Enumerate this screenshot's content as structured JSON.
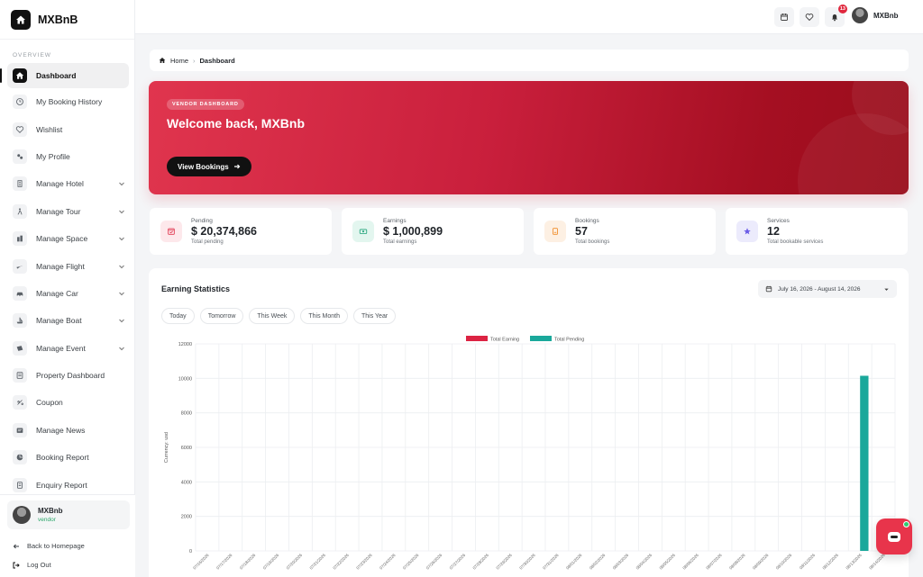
{
  "brand": {
    "name": "MXBnB"
  },
  "sidebar": {
    "section": "OVERVIEW",
    "items": [
      {
        "label": "Dashboard",
        "icon": "home-icon",
        "active": true
      },
      {
        "label": "My Booking History",
        "icon": "clock-icon"
      },
      {
        "label": "Wishlist",
        "icon": "heart-icon"
      },
      {
        "label": "My Profile",
        "icon": "users-icon"
      },
      {
        "label": "Manage Hotel",
        "icon": "building-icon",
        "expandable": true
      },
      {
        "label": "Manage Tour",
        "icon": "hiker-icon",
        "expandable": true
      },
      {
        "label": "Manage Space",
        "icon": "space-icon",
        "expandable": true
      },
      {
        "label": "Manage Flight",
        "icon": "plane-icon",
        "expandable": true
      },
      {
        "label": "Manage Car",
        "icon": "car-icon",
        "expandable": true
      },
      {
        "label": "Manage Boat",
        "icon": "boat-icon",
        "expandable": true
      },
      {
        "label": "Manage Event",
        "icon": "ticket-icon",
        "expandable": true
      },
      {
        "label": "Property Dashboard",
        "icon": "property-icon"
      },
      {
        "label": "Coupon",
        "icon": "coupon-icon"
      },
      {
        "label": "Manage News",
        "icon": "news-icon"
      },
      {
        "label": "Booking Report",
        "icon": "report-icon"
      },
      {
        "label": "Enquiry Report",
        "icon": "enquiry-icon"
      }
    ],
    "user": {
      "name": "MXBnb",
      "role": "vendor"
    },
    "back_link": "Back to Homepage",
    "logout": "Log Out"
  },
  "topbar": {
    "notifications": "13",
    "user_name": "MXBnb"
  },
  "breadcrumb": {
    "home": "Home",
    "current": "Dashboard"
  },
  "hero": {
    "tag": "VENDOR DASHBOARD",
    "title": "Welcome back, MXBnb",
    "button": "View Bookings"
  },
  "stats": [
    {
      "label": "Pending",
      "value": "$ 20,374,866",
      "sub": "Total pending",
      "icon": "calendar-check-icon",
      "color": "#e0354e",
      "bg": "#fde8eb"
    },
    {
      "label": "Earnings",
      "value": "$ 1,000,899",
      "sub": "Total earnings",
      "icon": "money-icon",
      "color": "#1fa37a",
      "bg": "#e3f6ef"
    },
    {
      "label": "Bookings",
      "value": "57",
      "sub": "Total bookings",
      "icon": "bookmark-icon",
      "color": "#f08a24",
      "bg": "#fdf0e3"
    },
    {
      "label": "Services",
      "value": "12",
      "sub": "Total bookable services",
      "icon": "star-icon",
      "color": "#6b5ce7",
      "bg": "#ecebfc"
    }
  ],
  "earning": {
    "title": "Earning Statistics",
    "date_range": "July 16, 2026 - August 14, 2026",
    "filters": [
      "Today",
      "Tomorrow",
      "This Week",
      "This Month",
      "This Year"
    ]
  },
  "chart_data": {
    "type": "bar",
    "ylabel": "Currency: usd",
    "ylim": [
      0,
      12000
    ],
    "yticks": [
      0,
      2000,
      4000,
      6000,
      8000,
      10000,
      12000
    ],
    "categories": [
      "07/16/2026",
      "07/17/2026",
      "07/18/2026",
      "07/19/2026",
      "07/20/2026",
      "07/21/2026",
      "07/22/2026",
      "07/23/2026",
      "07/24/2026",
      "07/25/2026",
      "07/26/2026",
      "07/27/2026",
      "07/28/2026",
      "07/29/2026",
      "07/30/2026",
      "07/31/2026",
      "08/01/2026",
      "08/02/2026",
      "08/03/2026",
      "08/04/2026",
      "08/05/2026",
      "08/06/2026",
      "08/07/2026",
      "08/08/2026",
      "08/09/2026",
      "08/10/2026",
      "08/11/2026",
      "08/12/2026",
      "08/13/2026",
      "08/14/2026"
    ],
    "series": [
      {
        "name": "Total Earning",
        "color": "#dc2343",
        "values": [
          0,
          0,
          0,
          0,
          0,
          0,
          0,
          0,
          0,
          0,
          0,
          0,
          0,
          0,
          0,
          0,
          0,
          0,
          0,
          0,
          0,
          0,
          0,
          0,
          0,
          0,
          0,
          0,
          0,
          0
        ]
      },
      {
        "name": "Total Pending",
        "color": "#1aa89b",
        "values": [
          0,
          0,
          0,
          0,
          0,
          0,
          0,
          0,
          0,
          0,
          0,
          0,
          0,
          0,
          0,
          0,
          0,
          0,
          0,
          0,
          0,
          0,
          0,
          0,
          0,
          0,
          0,
          0,
          10150,
          0
        ]
      }
    ],
    "legend": "top",
    "grid": true
  }
}
